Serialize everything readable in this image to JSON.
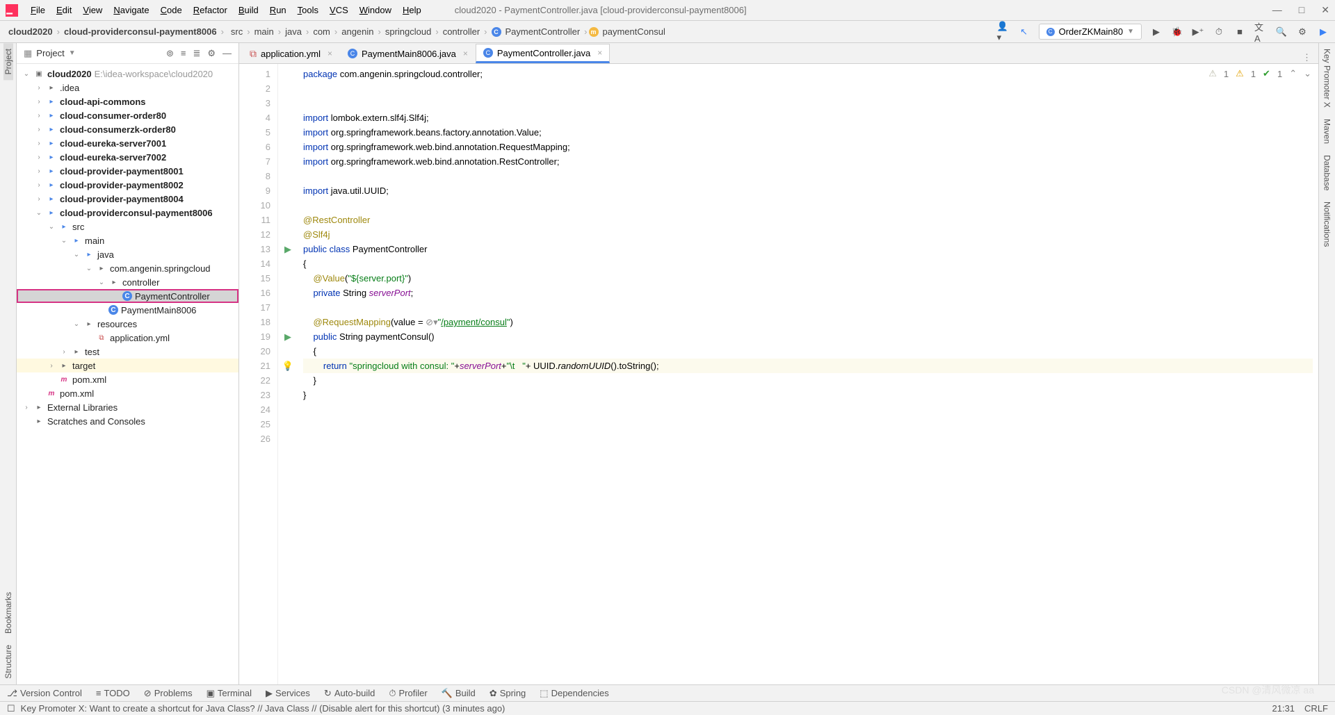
{
  "window": {
    "title": "cloud2020 - PaymentController.java [cloud-providerconsul-payment8006]"
  },
  "menu": [
    "File",
    "Edit",
    "View",
    "Navigate",
    "Code",
    "Refactor",
    "Build",
    "Run",
    "Tools",
    "VCS",
    "Window",
    "Help"
  ],
  "breadcrumbs": {
    "root": "cloud2020",
    "module": "cloud-providerconsul-payment8006",
    "parts": [
      "src",
      "main",
      "java",
      "com",
      "angenin",
      "springcloud",
      "controller"
    ],
    "class": "PaymentController",
    "method": "paymentConsul"
  },
  "run_config": "OrderZKMain80",
  "sidebar": {
    "label": "Project",
    "root": {
      "name": "cloud2020",
      "path": "E:\\idea-workspace\\cloud2020"
    },
    "tree": [
      {
        "ind": 1,
        "arr": "col",
        "ico": "folder",
        "name": ".idea"
      },
      {
        "ind": 1,
        "arr": "col",
        "ico": "module",
        "name": "cloud-api-commons",
        "bold": true
      },
      {
        "ind": 1,
        "arr": "col",
        "ico": "module",
        "name": "cloud-consumer-order80",
        "bold": true
      },
      {
        "ind": 1,
        "arr": "col",
        "ico": "module",
        "name": "cloud-consumerzk-order80",
        "bold": true
      },
      {
        "ind": 1,
        "arr": "col",
        "ico": "module",
        "name": "cloud-eureka-server7001",
        "bold": true
      },
      {
        "ind": 1,
        "arr": "col",
        "ico": "module",
        "name": "cloud-eureka-server7002",
        "bold": true
      },
      {
        "ind": 1,
        "arr": "col",
        "ico": "module",
        "name": "cloud-provider-payment8001",
        "bold": true
      },
      {
        "ind": 1,
        "arr": "col",
        "ico": "module",
        "name": "cloud-provider-payment8002",
        "bold": true
      },
      {
        "ind": 1,
        "arr": "col",
        "ico": "module",
        "name": "cloud-provider-payment8004",
        "bold": true
      },
      {
        "ind": 1,
        "arr": "exp",
        "ico": "module",
        "name": "cloud-providerconsul-payment8006",
        "bold": true
      },
      {
        "ind": 2,
        "arr": "exp",
        "ico": "folder-blue",
        "name": "src"
      },
      {
        "ind": 3,
        "arr": "exp",
        "ico": "folder-blue",
        "name": "main"
      },
      {
        "ind": 4,
        "arr": "exp",
        "ico": "folder-blue",
        "name": "java"
      },
      {
        "ind": 5,
        "arr": "exp",
        "ico": "folder",
        "name": "com.angenin.springcloud"
      },
      {
        "ind": 6,
        "arr": "exp",
        "ico": "folder",
        "name": "controller"
      },
      {
        "ind": 7,
        "arr": "",
        "ico": "c-ico",
        "name": "PaymentController",
        "selected": true
      },
      {
        "ind": 6,
        "arr": "",
        "ico": "c-ico",
        "name": "PaymentMain8006"
      },
      {
        "ind": 4,
        "arr": "exp",
        "ico": "folder",
        "name": "resources"
      },
      {
        "ind": 5,
        "arr": "",
        "ico": "yml",
        "name": "application.yml"
      },
      {
        "ind": 3,
        "arr": "col",
        "ico": "folder",
        "name": "test"
      },
      {
        "ind": 2,
        "arr": "col",
        "ico": "folder",
        "name": "target",
        "hl": true
      },
      {
        "ind": 2,
        "arr": "",
        "ico": "m-ico",
        "name": "pom.xml"
      },
      {
        "ind": 1,
        "arr": "",
        "ico": "m-ico",
        "name": "pom.xml"
      },
      {
        "ind": 0,
        "arr": "col",
        "ico": "folder",
        "name": "External Libraries"
      },
      {
        "ind": 0,
        "arr": "",
        "ico": "folder",
        "name": "Scratches and Consoles"
      }
    ]
  },
  "tabs": [
    {
      "label": "application.yml",
      "icon": "yml"
    },
    {
      "label": "PaymentMain8006.java",
      "icon": "c"
    },
    {
      "label": "PaymentController.java",
      "icon": "c",
      "active": true
    }
  ],
  "code": {
    "lines": [
      {
        "n": 1,
        "h": "<span class='kw'>package</span> com.angenin.springcloud.controller;"
      },
      {
        "n": 2,
        "h": ""
      },
      {
        "n": 3,
        "h": ""
      },
      {
        "n": 4,
        "h": "<span class='kw'>import</span> lombok.extern.slf4j.<span class='cls'>Slf4j</span>;"
      },
      {
        "n": 5,
        "h": "<span class='kw'>import</span> org.springframework.beans.factory.annotation.<span class='cls'>Value</span>;"
      },
      {
        "n": 6,
        "h": "<span class='kw'>import</span> org.springframework.web.bind.annotation.<span class='cls'>RequestMapping</span>;"
      },
      {
        "n": 7,
        "h": "<span class='kw'>import</span> org.springframework.web.bind.annotation.<span class='cls'>RestController</span>;"
      },
      {
        "n": 8,
        "h": ""
      },
      {
        "n": 9,
        "h": "<span class='kw'>import</span> java.util.UUID;"
      },
      {
        "n": 10,
        "h": ""
      },
      {
        "n": 11,
        "h": "<span class='ann'>@RestController</span>"
      },
      {
        "n": 12,
        "h": "<span class='ann'>@Slf4j</span>"
      },
      {
        "n": 13,
        "h": "<span class='kw'>public class</span> <span class='cls'>PaymentController</span>",
        "gi": "run"
      },
      {
        "n": 14,
        "h": "{"
      },
      {
        "n": 15,
        "h": "    <span class='ann'>@Value</span>(<span class='str'>\"${server.port}\"</span>)"
      },
      {
        "n": 16,
        "h": "    <span class='kw'>private</span> String <span class='fld'>serverPort</span>;"
      },
      {
        "n": 17,
        "h": ""
      },
      {
        "n": 18,
        "h": "    <span class='ann'>@RequestMapping</span>(value = <span class='com'>⊘▾</span><span class='str'>\"</span><span class='strlink'>/payment/consul</span><span class='str'>\"</span>)"
      },
      {
        "n": 19,
        "h": "    <span class='kw'>public</span> String <span class='cls'>paymentConsul</span>()",
        "gi": "run"
      },
      {
        "n": 20,
        "h": "    {"
      },
      {
        "n": 21,
        "h": "        <span class='kw'>return</span> <span class='str'>\"springcloud with consul: \"</span>+<span class='fld'>serverPort</span>+<span class='str'>\"\\t   \"</span>+ UUID.<span class='mstatic'>randomUUID</span>().toString();",
        "hl": true,
        "gi": "bulb"
      },
      {
        "n": 22,
        "h": "    }"
      },
      {
        "n": 23,
        "h": "}"
      },
      {
        "n": 24,
        "h": ""
      },
      {
        "n": 25,
        "h": ""
      },
      {
        "n": 26,
        "h": ""
      }
    ]
  },
  "inspection": {
    "weak": "1",
    "warn": "1",
    "ok": "1"
  },
  "left_tabs": [
    "Project",
    "Bookmarks",
    "Structure"
  ],
  "right_tabs": [
    "Key Promoter X",
    "Maven",
    "Database",
    "Notifications"
  ],
  "bottom_tools": [
    "Version Control",
    "TODO",
    "Problems",
    "Terminal",
    "Services",
    "Auto-build",
    "Profiler",
    "Build",
    "Spring",
    "Dependencies"
  ],
  "status": {
    "msg": "Key Promoter X: Want to create a shortcut for Java Class? // Java Class // (Disable alert for this shortcut) (3 minutes ago)",
    "pos": "21:31",
    "enc": "CRLF"
  }
}
